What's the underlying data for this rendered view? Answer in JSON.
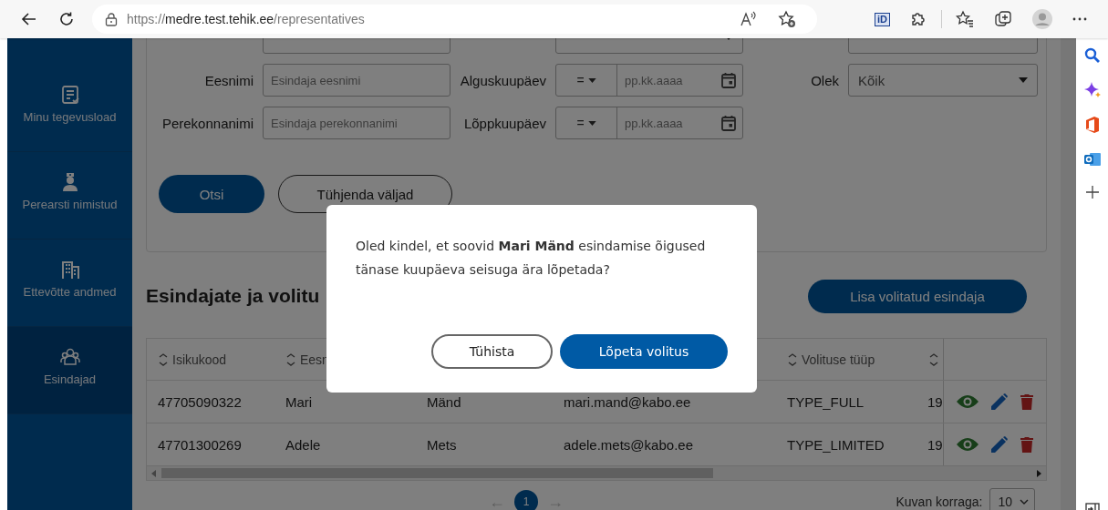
{
  "browser": {
    "address": "https://medre.test.tehik.ee/representatives",
    "extension_badge": "iD"
  },
  "sidebar": {
    "items": [
      {
        "label": "Minu tegevusload",
        "selected": false
      },
      {
        "label": "Perearsti nimistud",
        "selected": false
      },
      {
        "label": "Ettevõtte andmed",
        "selected": false
      },
      {
        "label": "Esindajad",
        "selected": true
      }
    ]
  },
  "filters": {
    "rows": [
      [
        {
          "kind": "text"
        },
        {
          "kind": "select"
        },
        {
          "kind": "text"
        }
      ],
      [
        {
          "kind": "text",
          "label": "Eesnimi",
          "placeholder": "Esindaja eesnimi"
        },
        {
          "kind": "date",
          "label": "Alguskuupäev",
          "operator": "=",
          "placeholder": "pp.kk.aaaa"
        },
        {
          "kind": "select",
          "label": "Olek",
          "value": "Kõik"
        }
      ],
      [
        {
          "kind": "text",
          "label": "Perekonnanimi",
          "placeholder": "Esindaja perekonnanimi"
        },
        {
          "kind": "date",
          "label": "Lõppkuupäev",
          "operator": "=",
          "placeholder": "pp.kk.aaaa"
        }
      ]
    ],
    "buttons": [
      {
        "label": "Otsi",
        "kind": "primary"
      },
      {
        "label": "Tühjenda väljad",
        "kind": "outline"
      }
    ]
  },
  "section": {
    "title": "Esindajate ja volitu",
    "add_button": "Lisa volitatud esindaja"
  },
  "table": {
    "columns": [
      {
        "label": "Isikukood",
        "kind": "sortable"
      },
      {
        "label": "Eesn",
        "kind": "sortable"
      },
      null,
      null,
      {
        "label": "Volituse tüüp",
        "kind": "sortable"
      },
      {
        "kind": "sortable"
      }
    ],
    "rows": [
      {
        "cells": [
          "47705090322",
          "Mari",
          "Mänd",
          "mari.mand@kabo.ee",
          "TYPE_FULL",
          "19"
        ]
      },
      {
        "cells": [
          "47701300269",
          "Adele",
          "Mets",
          "adele.mets@kabo.ee",
          "TYPE_LIMITED",
          "19"
        ]
      }
    ]
  },
  "pagination": {
    "prev": "←",
    "pages": [
      {
        "label": "1",
        "selected": true
      }
    ],
    "next": "→",
    "page_size_label": "Kuvan korraga:",
    "page_size": "10"
  },
  "dialog": {
    "message": "Oled kindel, et soovid **Mari Mänd** esindamise õigused tänase kuupäeva seisuga ära lõpetada?",
    "buttons": [
      {
        "label": "Tühista",
        "kind": "outline"
      },
      {
        "label": "Lõpeta volitus",
        "kind": "primary"
      }
    ]
  }
}
